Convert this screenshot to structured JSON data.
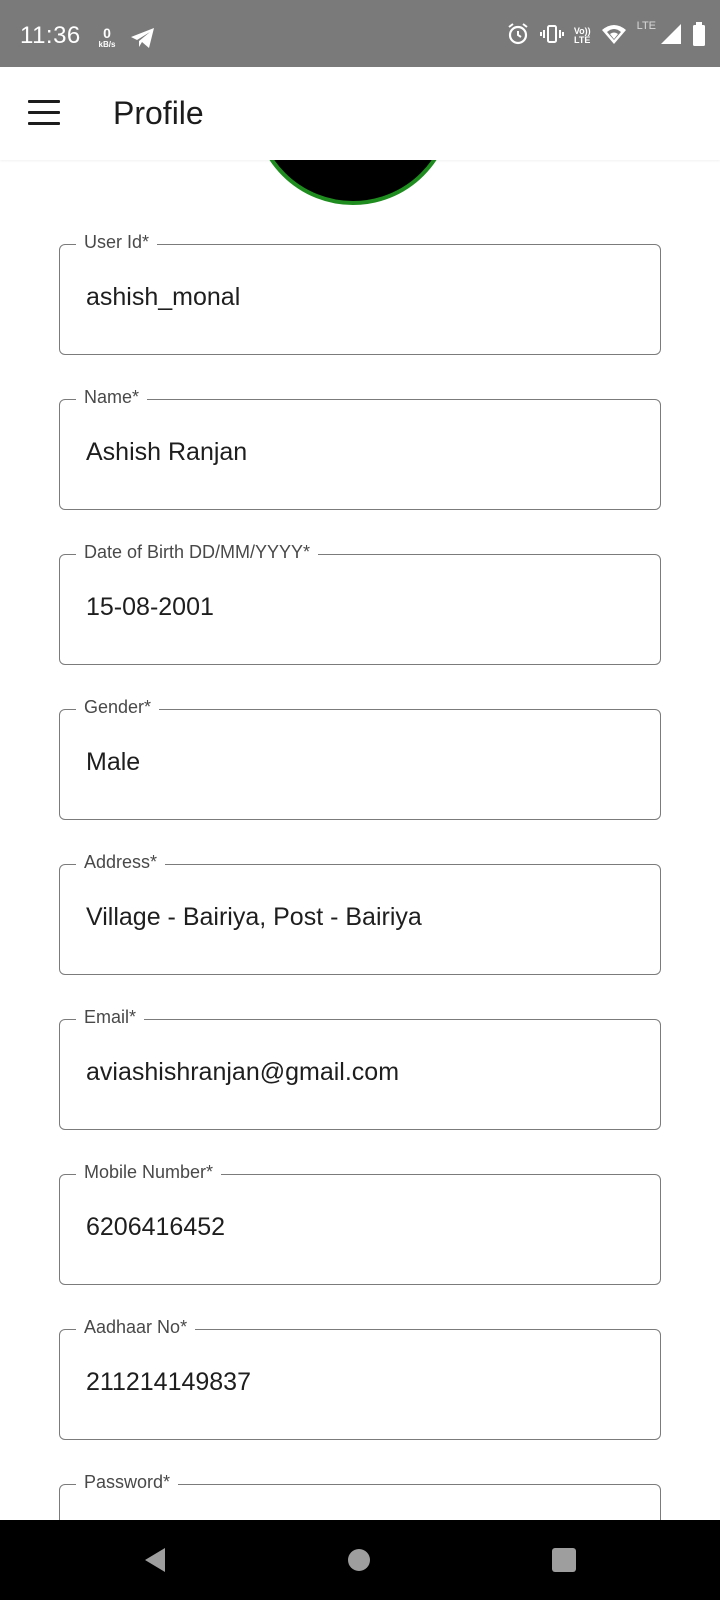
{
  "status_bar": {
    "time": "11:36",
    "net_speed_value": "0",
    "net_speed_unit": "kB/s",
    "volte_line1": "Vo))",
    "volte_line2": "LTE",
    "lte_label": "LTE",
    "icons": [
      "telegram-icon",
      "alarm-icon",
      "vibrate-icon",
      "volte-icon",
      "wifi-icon",
      "signal-icon",
      "battery-icon"
    ]
  },
  "app_bar": {
    "title": "Profile",
    "menu_icon": "menu-icon"
  },
  "avatar": {
    "fill_color": "#000000",
    "border_color": "#1f8c1f"
  },
  "fields": [
    {
      "label": "User Id*",
      "value": "ashish_monal"
    },
    {
      "label": "Name*",
      "value": "Ashish Ranjan"
    },
    {
      "label": "Date of Birth DD/MM/YYYY*",
      "value": "15-08-2001"
    },
    {
      "label": "Gender*",
      "value": "Male"
    },
    {
      "label": "Address*",
      "value": "Village - Bairiya, Post - Bairiya"
    },
    {
      "label": "Email*",
      "value": "aviashishranjan@gmail.com"
    },
    {
      "label": "Mobile Number*",
      "value": "6206416452"
    },
    {
      "label": "Aadhaar No*",
      "value": "211214149837"
    },
    {
      "label": "Password*",
      "value": ""
    }
  ],
  "nav_bar": {
    "icons": [
      "back-icon",
      "home-icon",
      "recents-icon"
    ]
  }
}
